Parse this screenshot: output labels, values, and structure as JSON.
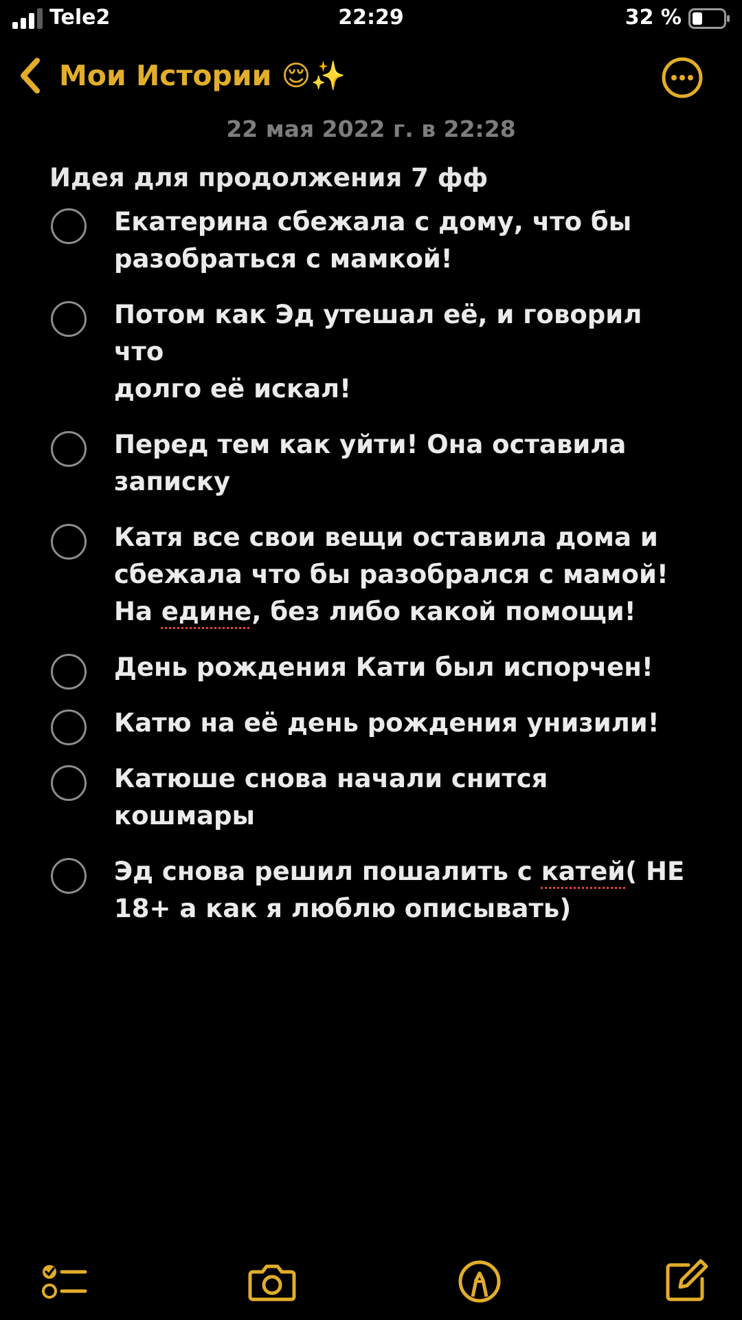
{
  "status_bar": {
    "carrier": "Tele2",
    "time": "22:29",
    "battery_percent": "32 %",
    "battery_level": 0.32,
    "signal_bars_filled": 3
  },
  "nav": {
    "back_label": "Мои Истории 😌✨",
    "back_icon": "chevron-left-icon",
    "more_icon": "ellipsis-circle-icon"
  },
  "note": {
    "date": "22 мая 2022 г. в 22:28",
    "title": "Идея для продолжения 7 фф",
    "items": [
      {
        "text": "Екатерина сбежала с дому, что бы\nразобраться с мамкой!",
        "checked": false
      },
      {
        "text": "Потом как Эд утешал её, и говорил что\nдолго её искал!",
        "checked": false
      },
      {
        "text": "Перед тем как уйти! Она оставила\nзаписку",
        "checked": false
      },
      {
        "text": "Катя все свои вещи оставила дома и\nсбежала что бы разобрался с мамой!",
        "text_end_before": "На ",
        "text_end_flagged": "едине",
        "text_end_after": ", без либо какой помощи!",
        "checked": false
      },
      {
        "text": "День рождения Кати был испорчен!",
        "checked": false
      },
      {
        "text": "Катю на её день рождения унизили!",
        "checked": false
      },
      {
        "text": "Катюше снова начали снится кошмары",
        "checked": false
      },
      {
        "text_before": "Эд снова решил пошалить с ",
        "text_flagged": "катей",
        "text_after": "( НЕ\n18+ а как я люблю описывать)",
        "checked": false
      }
    ]
  },
  "toolbar": {
    "items": [
      "checklist-icon",
      "camera-icon",
      "markup-pen-icon",
      "compose-icon"
    ]
  },
  "colors": {
    "background": "#000000",
    "accent": "#e2ad2a",
    "text": "#ebebeb",
    "secondary_text": "#7d7d7d",
    "circle": "#8d8d8d",
    "spellcheck": "#e0423a"
  }
}
